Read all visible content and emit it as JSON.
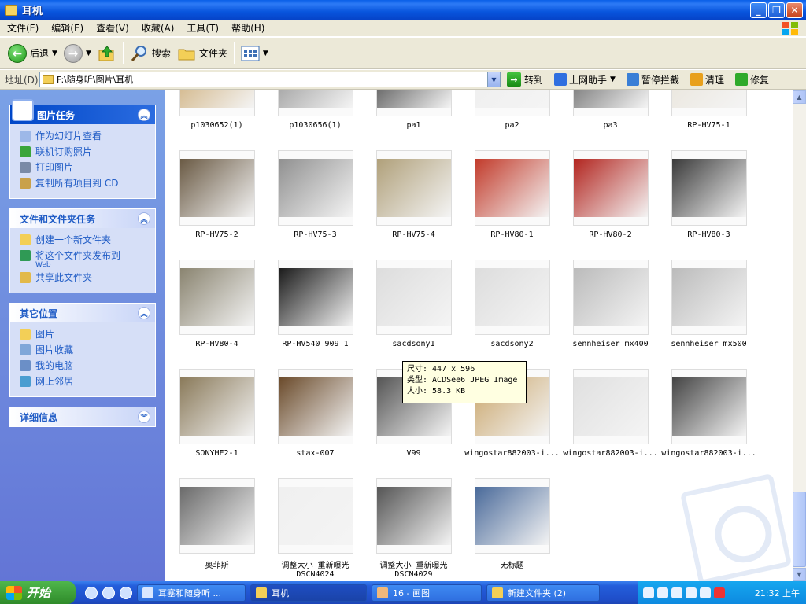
{
  "window": {
    "title": "耳机"
  },
  "menu": [
    "文件(F)",
    "编辑(E)",
    "查看(V)",
    "收藏(A)",
    "工具(T)",
    "帮助(H)"
  ],
  "toolbar": {
    "back": "后退",
    "search": "搜索",
    "folders": "文件夹"
  },
  "address": {
    "label": "地址(D)",
    "path": "F:\\随身听\\图片\\耳机",
    "go": "转到",
    "buttons": [
      "上网助手",
      "暂停拦截",
      "清理",
      "修复"
    ]
  },
  "panels": {
    "picture_tasks": {
      "title": "图片任务",
      "items": [
        "作为幻灯片查看",
        "联机订购照片",
        "打印图片",
        "复制所有项目到 CD"
      ]
    },
    "file_tasks": {
      "title": "文件和文件夹任务",
      "items": [
        "创建一个新文件夹",
        "将这个文件夹发布到",
        "共享此文件夹"
      ],
      "publish_sub": "Web"
    },
    "other_places": {
      "title": "其它位置",
      "items": [
        "图片",
        "图片收藏",
        "我的电脑",
        "网上邻居"
      ]
    },
    "details": {
      "title": "详细信息"
    }
  },
  "files": [
    "p1030652(1)",
    "p1030656(1)",
    "pa1",
    "pa2",
    "pa3",
    "RP-HV75-1",
    "RP-HV75-2",
    "RP-HV75-3",
    "RP-HV75-4",
    "RP-HV80-1",
    "RP-HV80-2",
    "RP-HV80-3",
    "RP-HV80-4",
    "RP-HV540_909_1",
    "sacdsony1",
    "sacdsony2",
    "sennheiser_mx400",
    "sennheiser_mx500",
    "SONYHE2-1",
    "stax-007",
    "V99",
    "wingostar882003-i...",
    "wingostar882003-i...",
    "wingostar882003-i...",
    "奥菲斯",
    "调整大小 重新曝光\nDSCN4024",
    "调整大小 重新曝光\nDSCN4029",
    "无标题"
  ],
  "tooltip": {
    "line1": "尺寸: 447 x 596",
    "line2": "类型: ACDSee6 JPEG Image",
    "line3": "大小: 58.3 KB"
  },
  "taskbar": {
    "start": "开始",
    "tasks": [
      "耳塞和随身听 ...",
      "耳机",
      "16 - 画图",
      "新建文件夹 (2)"
    ],
    "clock": "21:32 上午"
  },
  "colors": {
    "titlebar": "#0855dd",
    "pane": "#6f8ddf",
    "link": "#215dc6"
  }
}
